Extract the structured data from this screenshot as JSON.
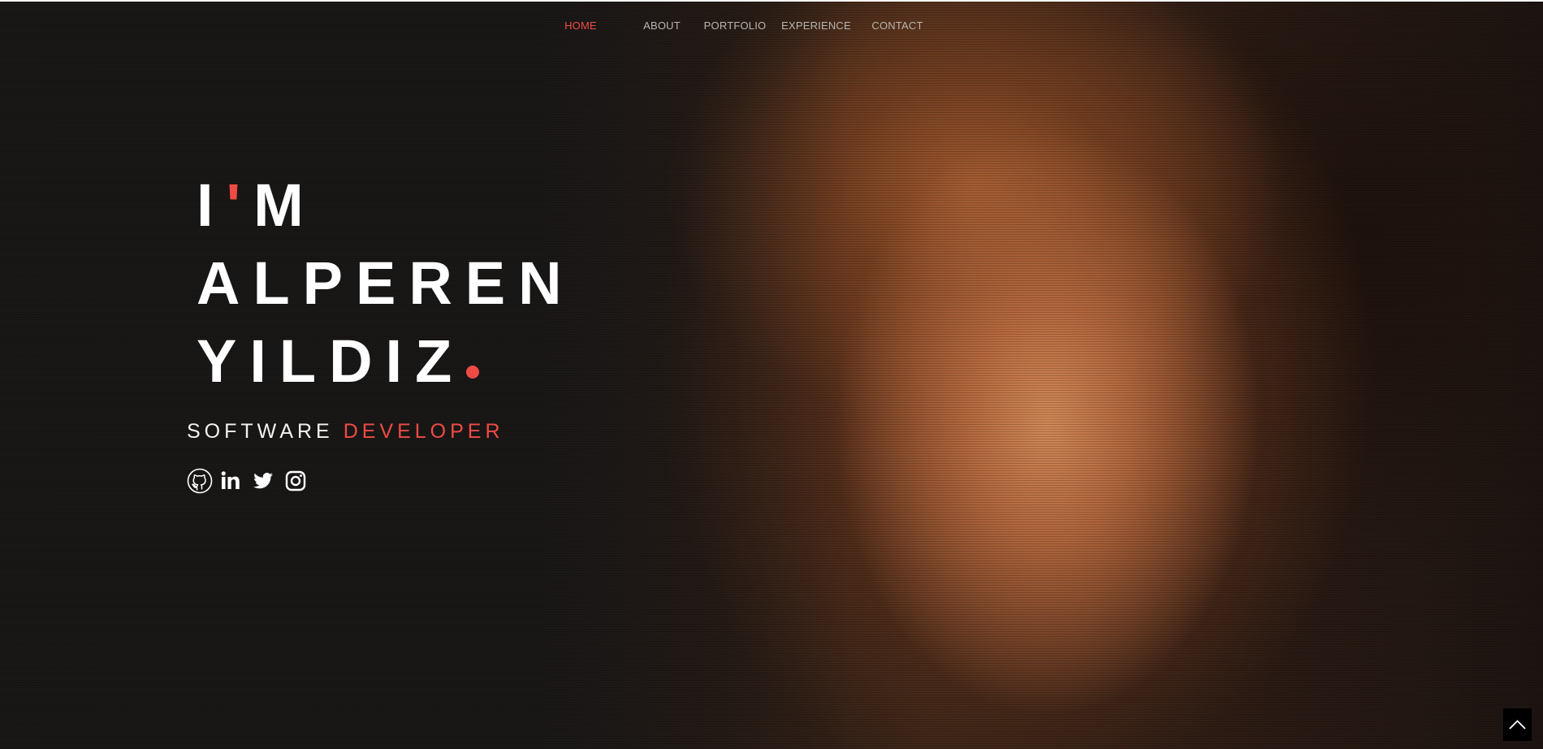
{
  "nav": {
    "items": [
      {
        "label": "HOME",
        "active": true
      },
      {
        "label": "ABOUT",
        "active": false
      },
      {
        "label": "PORTFOLIO",
        "active": false
      },
      {
        "label": "EXPERIENCE",
        "active": false
      },
      {
        "label": "CONTACT",
        "active": false
      }
    ]
  },
  "hero": {
    "line1_part1": "I",
    "line1_apostrophe": "'",
    "line1_part2": "M",
    "line2": "ALPEREN",
    "line3": "YILDIZ",
    "subtitle_part1": "SOFTWARE",
    "subtitle_part2": "DEVELOPER"
  },
  "socials": [
    {
      "icon": "github-icon"
    },
    {
      "icon": "linkedin-icon"
    },
    {
      "icon": "twitter-icon"
    },
    {
      "icon": "instagram-icon"
    }
  ],
  "colors": {
    "accent": "#ef4b45",
    "text": "#ffffff",
    "nav_text": "#b8b4b0",
    "background": "#1c1918"
  },
  "back_to_top": {
    "icon": "chevron-up-icon"
  }
}
